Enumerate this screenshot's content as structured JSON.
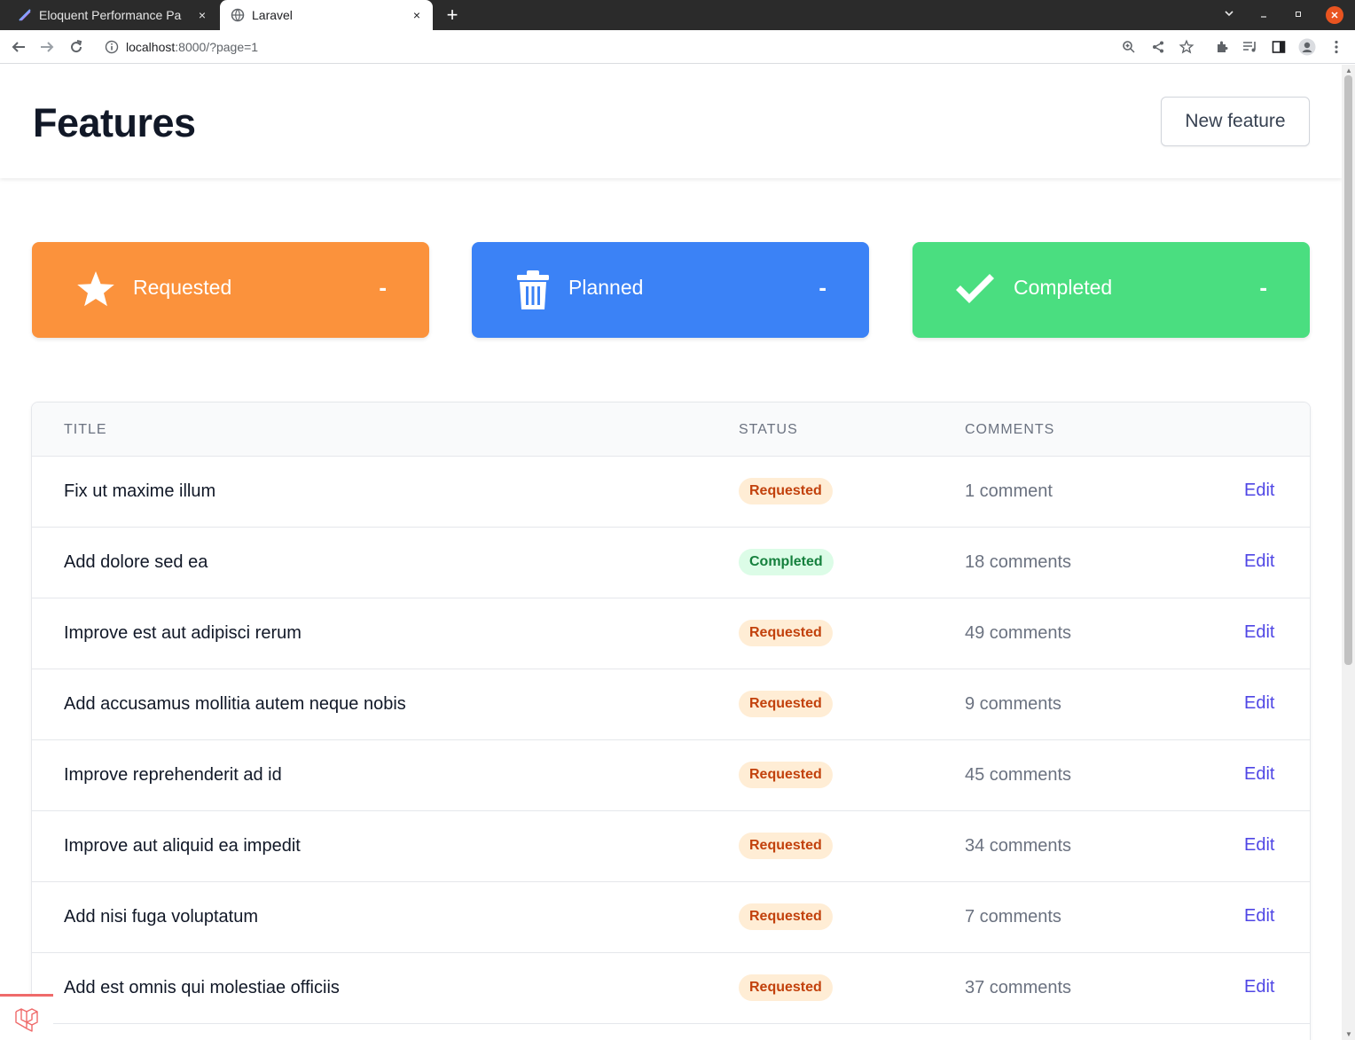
{
  "browser": {
    "tabs": [
      {
        "title": "Eloquent Performance Pa",
        "active": false
      },
      {
        "title": "Laravel",
        "active": true
      }
    ],
    "url_host": "localhost",
    "url_rest": ":8000/?page=1",
    "close_symbol": "×",
    "new_tab_symbol": "+"
  },
  "header": {
    "title": "Features",
    "new_feature_label": "New feature"
  },
  "stats": [
    {
      "label": "Requested",
      "value": "-",
      "icon": "star-icon",
      "color": "#fb923c"
    },
    {
      "label": "Planned",
      "value": "-",
      "icon": "trash-icon",
      "color": "#3b82f6"
    },
    {
      "label": "Completed",
      "value": "-",
      "icon": "check-icon",
      "color": "#4ade80"
    }
  ],
  "table": {
    "columns": [
      "TITLE",
      "STATUS",
      "COMMENTS"
    ],
    "rows": [
      {
        "title": "Fix ut maxime illum",
        "status": "Requested",
        "comments": "1 comment",
        "action": "Edit"
      },
      {
        "title": "Add dolore sed ea",
        "status": "Completed",
        "comments": "18 comments",
        "action": "Edit"
      },
      {
        "title": "Improve est aut adipisci rerum",
        "status": "Requested",
        "comments": "49 comments",
        "action": "Edit"
      },
      {
        "title": "Add accusamus mollitia autem neque nobis",
        "status": "Requested",
        "comments": "9 comments",
        "action": "Edit"
      },
      {
        "title": "Improve reprehenderit ad id",
        "status": "Requested",
        "comments": "45 comments",
        "action": "Edit"
      },
      {
        "title": "Improve aut aliquid ea impedit",
        "status": "Requested",
        "comments": "34 comments",
        "action": "Edit"
      },
      {
        "title": "Add nisi fuga voluptatum",
        "status": "Requested",
        "comments": "7 comments",
        "action": "Edit"
      },
      {
        "title": "Add est omnis qui molestiae officiis",
        "status": "Requested",
        "comments": "37 comments",
        "action": "Edit"
      }
    ]
  },
  "colors": {
    "requested_badge_bg": "#ffedd5",
    "requested_badge_text": "#c2410c",
    "completed_badge_bg": "#dcfce7",
    "completed_badge_text": "#15803d",
    "edit_link": "#4f46e5"
  }
}
